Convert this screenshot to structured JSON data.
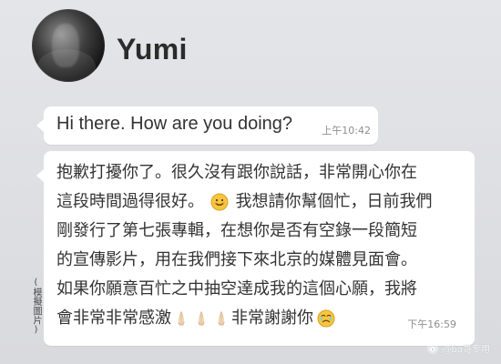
{
  "header": {
    "contact_name": "Yumi"
  },
  "messages": [
    {
      "text": "Hi there. How are you doing?",
      "time": "上午10:42"
    },
    {
      "lines": [
        "抱歉打擾你了。很久沒有跟你說話，非常開心你在",
        "這段時間過得很好。",
        "我想請你幫個忙，日前我們",
        "剛發行了第七張專輯，在想你是否有空錄一段簡短",
        "的宣傳影片，用在我們接下來北京的媒體見面會。",
        "如果你願意百忙之中抽空達成我的這個心願，我將",
        "會非常非常感激",
        "非常謝謝你"
      ],
      "time": "下午16:59"
    }
  ],
  "side_note": "(模擬圖片)",
  "watermark": "@ba哥专用",
  "icons": {
    "avatar": "profile-avatar",
    "smile": "smiling-face-icon",
    "hands": "folded-hands-icon",
    "cry": "crying-face-icon",
    "watermark": "weibo-icon"
  }
}
